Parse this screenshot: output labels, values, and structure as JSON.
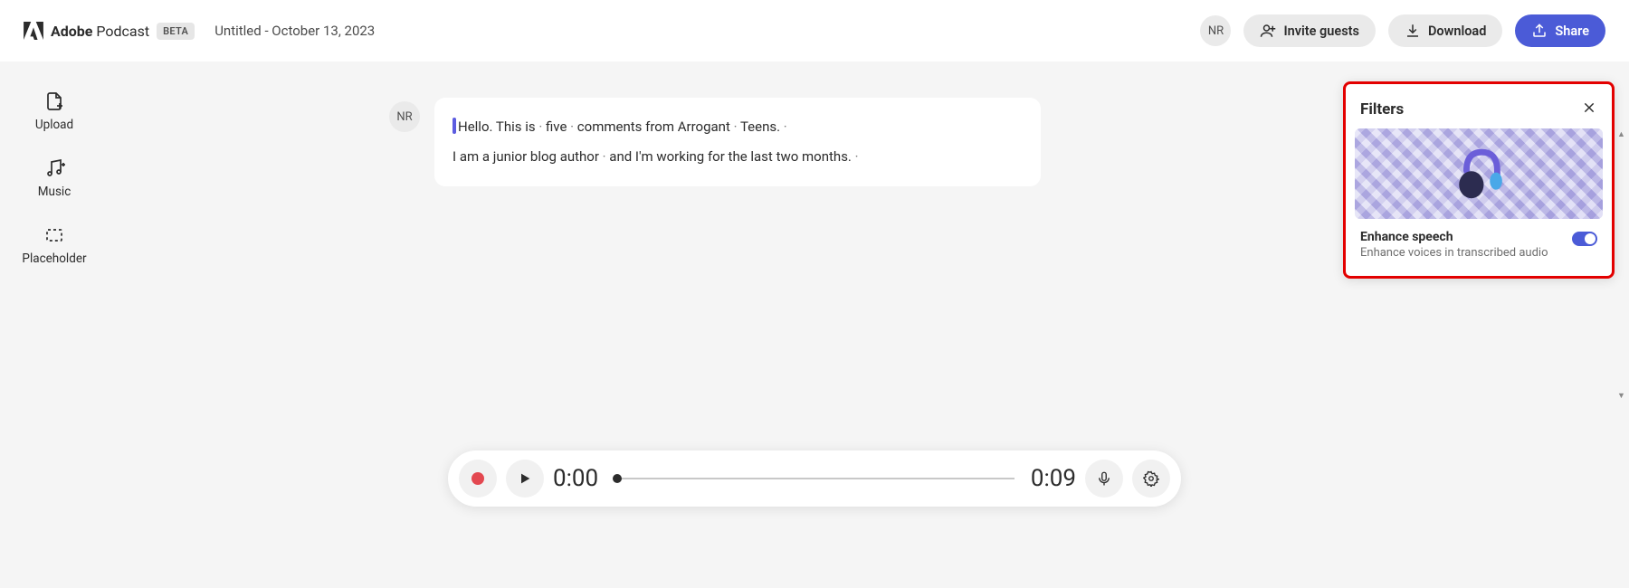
{
  "brand": {
    "strong": "Adobe",
    "rest": " Podcast",
    "badge": "BETA"
  },
  "project": {
    "title": "Untitled - October 13, 2023"
  },
  "user": {
    "initials": "NR"
  },
  "header_actions": {
    "invite": "Invite guests",
    "download": "Download",
    "share": "Share"
  },
  "sidebar": {
    "items": [
      {
        "id": "upload",
        "label": "Upload"
      },
      {
        "id": "music",
        "label": "Music"
      },
      {
        "id": "placeholder",
        "label": "Placeholder"
      }
    ]
  },
  "transcript": {
    "speaker_initials": "NR",
    "line1_words": [
      "Hello.",
      "This",
      "is",
      "·",
      "five",
      "·",
      "comments",
      "from",
      "Arrogant",
      "·",
      "Teens.",
      "·"
    ],
    "line2_words": [
      "I",
      "am",
      "a",
      "junior",
      "blog",
      "author",
      "·",
      "and",
      "I'm",
      "working",
      "for",
      "the",
      "last",
      "two",
      "months.",
      "·"
    ]
  },
  "filters": {
    "title": "Filters",
    "enhance_title": "Enhance speech",
    "enhance_desc": "Enhance voices in transcribed audio",
    "enabled": true
  },
  "playbar": {
    "current": "0:00",
    "duration": "0:09"
  }
}
